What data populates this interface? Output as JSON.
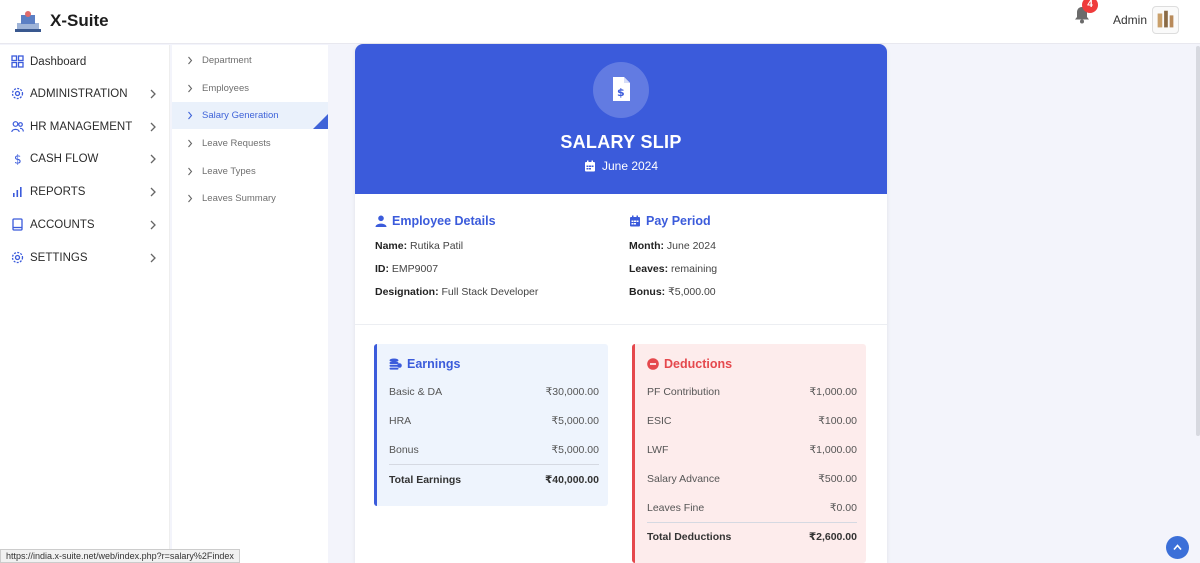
{
  "app": {
    "title": "X-Suite"
  },
  "header": {
    "notification_count": "4",
    "user_label": "Admin"
  },
  "sidebar": {
    "items": [
      {
        "label": "Dashboard",
        "icon": "grid-icon"
      },
      {
        "label": "ADMINISTRATION",
        "icon": "gear-icon"
      },
      {
        "label": "HR MANAGEMENT",
        "icon": "users-icon"
      },
      {
        "label": "CASH FLOW",
        "icon": "dollar-icon"
      },
      {
        "label": "REPORTS",
        "icon": "bar-chart-icon"
      },
      {
        "label": "ACCOUNTS",
        "icon": "book-icon"
      },
      {
        "label": "SETTINGS",
        "icon": "gear-icon"
      }
    ]
  },
  "submenu": {
    "items": [
      {
        "label": "Department"
      },
      {
        "label": "Employees"
      },
      {
        "label": "Salary Generation",
        "active": true
      },
      {
        "label": "Leave Requests"
      },
      {
        "label": "Leave Types"
      },
      {
        "label": "Leaves Summary"
      }
    ]
  },
  "slip": {
    "title": "SALARY SLIP",
    "period_label": "June 2024",
    "employee": {
      "heading": "Employee Details",
      "name_key": "Name:",
      "name_value": "Rutika Patil",
      "id_key": "ID:",
      "id_value": "EMP9007",
      "designation_key": "Designation:",
      "designation_value": "Full Stack Developer"
    },
    "pay_period": {
      "heading": "Pay Period",
      "month_key": "Month:",
      "month_value": "June 2024",
      "leaves_key": "Leaves:",
      "leaves_value": "remaining",
      "bonus_key": "Bonus:",
      "bonus_value": "₹5,000.00"
    },
    "earnings": {
      "heading": "Earnings",
      "rows": [
        {
          "label": "Basic & DA",
          "value": "₹30,000.00"
        },
        {
          "label": "HRA",
          "value": "₹5,000.00"
        },
        {
          "label": "Bonus",
          "value": "₹5,000.00"
        }
      ],
      "total_label": "Total Earnings",
      "total_value": "₹40,000.00"
    },
    "deductions": {
      "heading": "Deductions",
      "rows": [
        {
          "label": "PF Contribution",
          "value": "₹1,000.00"
        },
        {
          "label": "ESIC",
          "value": "₹100.00"
        },
        {
          "label": "LWF",
          "value": "₹1,000.00"
        },
        {
          "label": "Salary Advance",
          "value": "₹500.00"
        },
        {
          "label": "Leaves Fine",
          "value": "₹0.00"
        }
      ],
      "total_label": "Total Deductions",
      "total_value": "₹2,600.00"
    }
  },
  "status_bar": {
    "url": "https://india.x-suite.net/web/index.php?r=salary%2Findex"
  },
  "colors": {
    "primary": "#3b5bdb",
    "danger": "#e5484d",
    "earnings_bg": "#eef4fd",
    "deductions_bg": "#fdecec"
  }
}
